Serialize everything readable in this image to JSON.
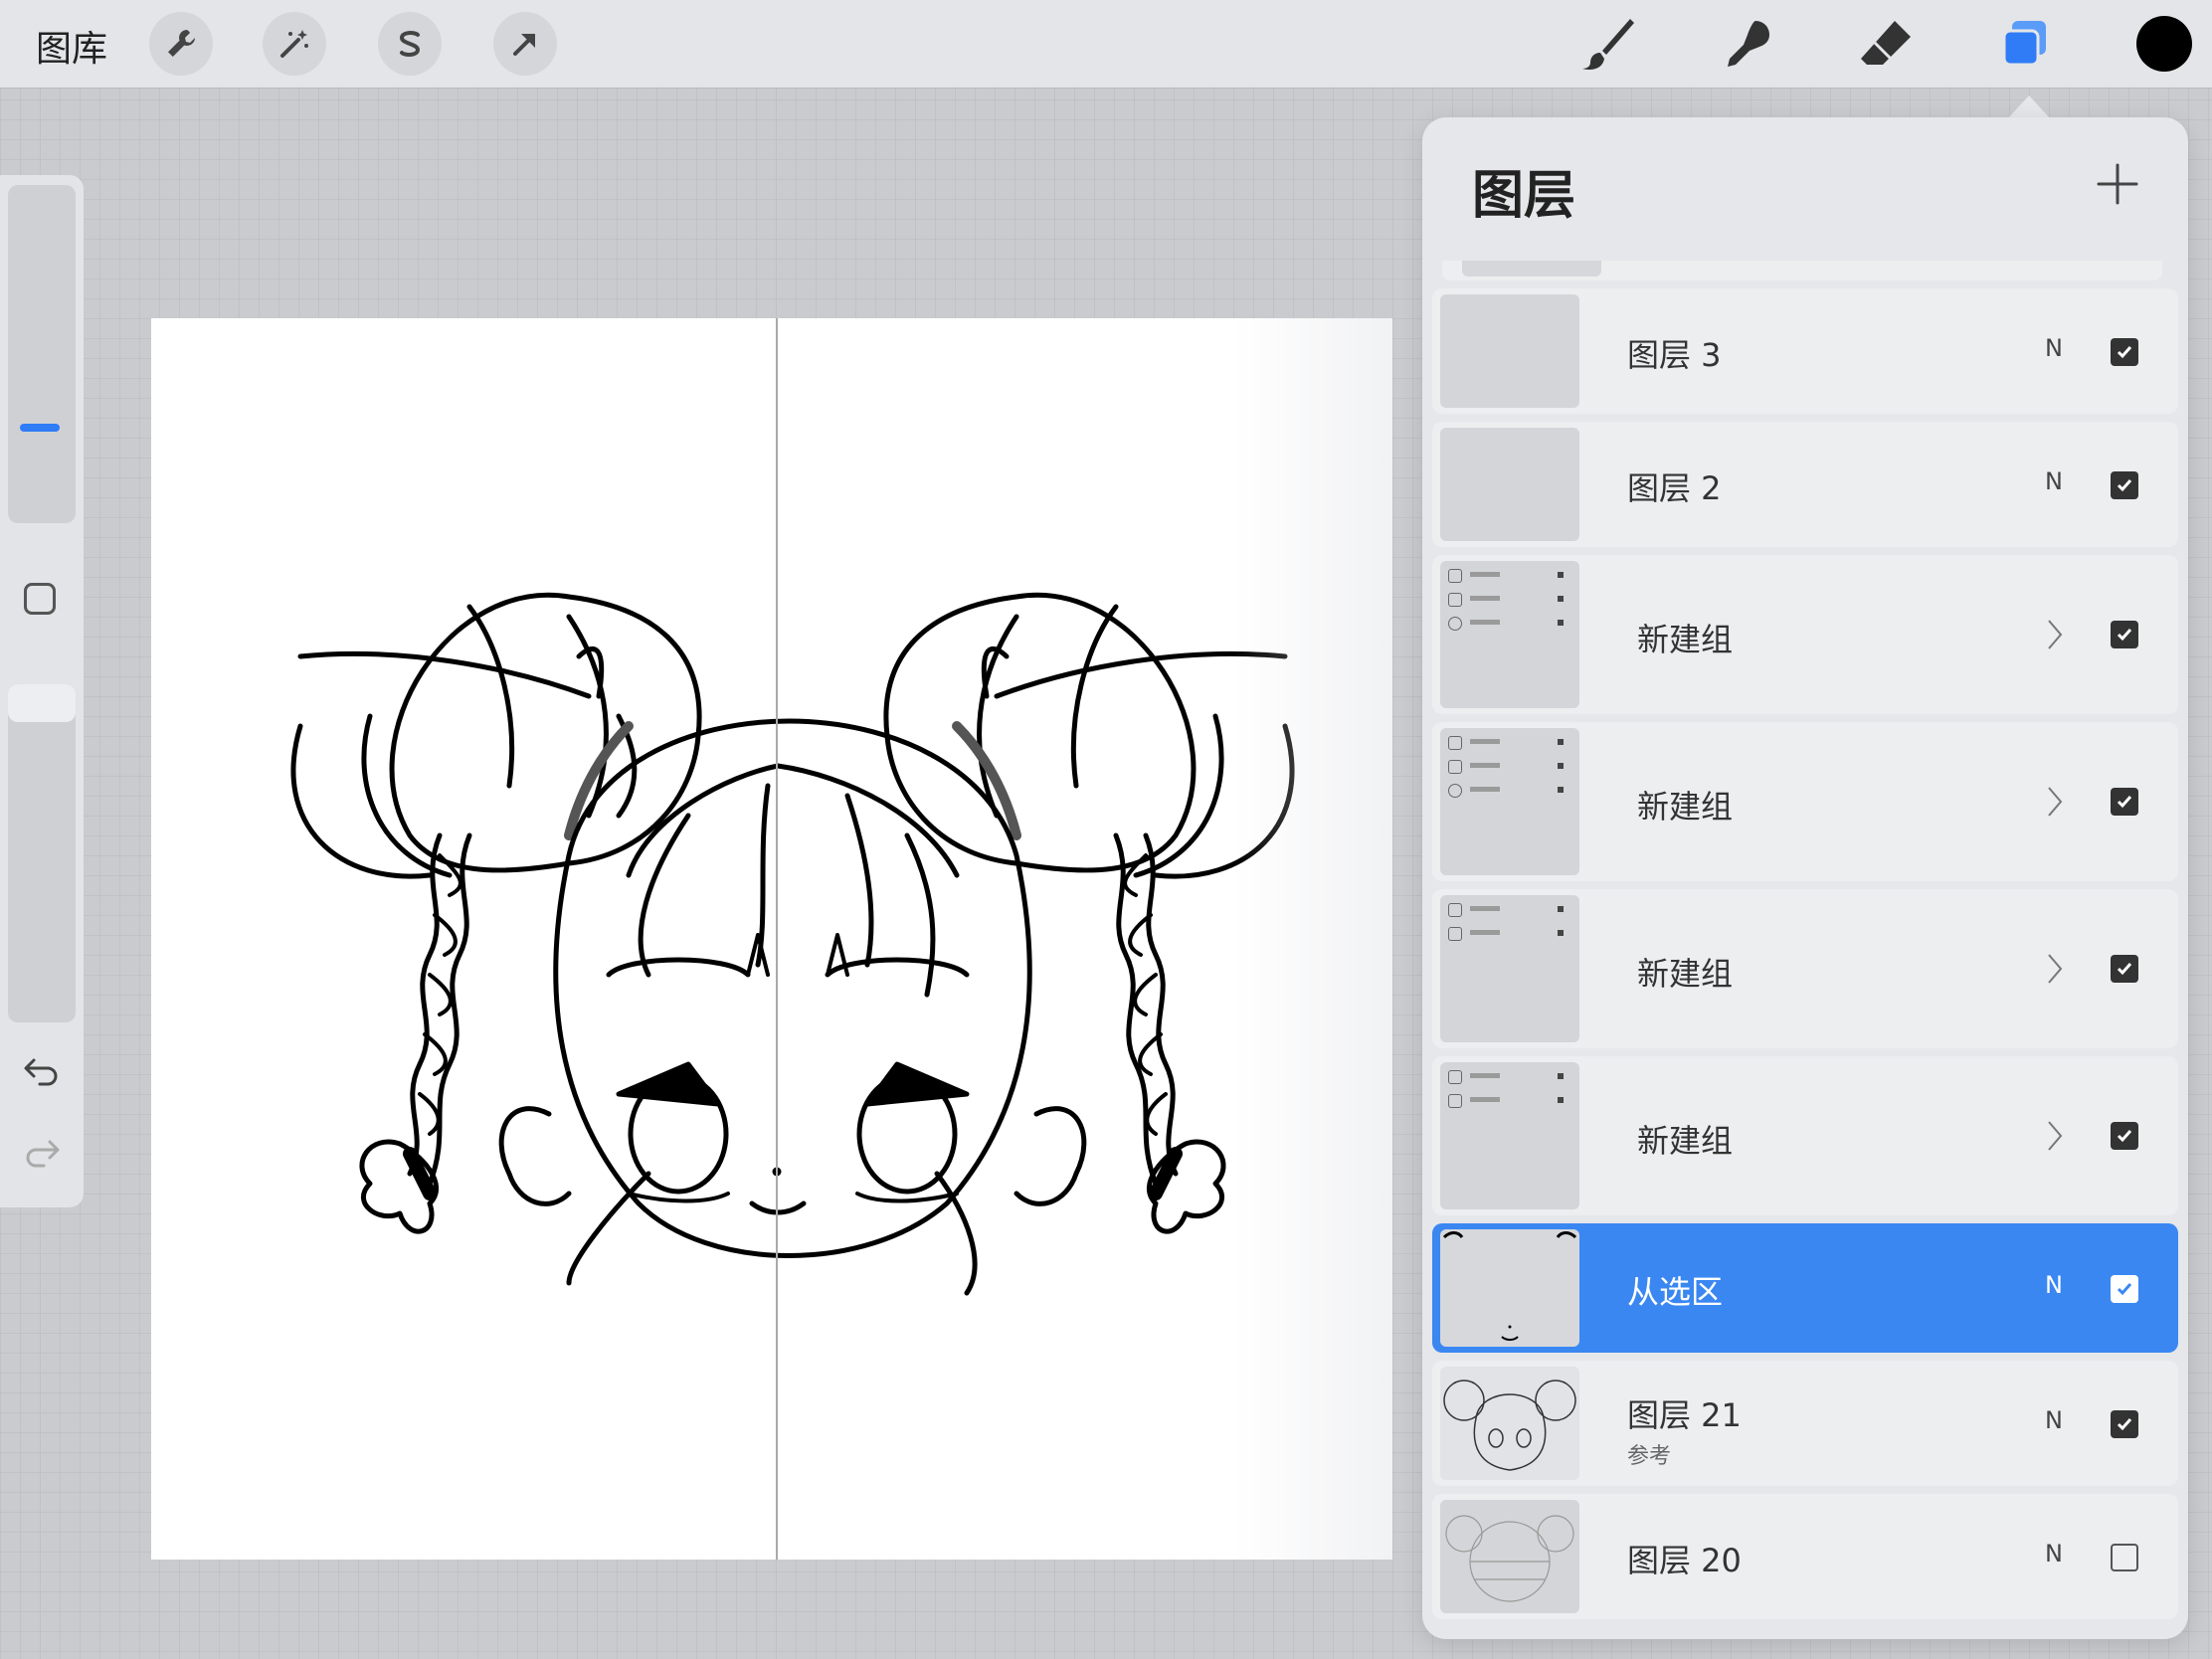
{
  "toolbar": {
    "gallery_label": "图库",
    "left_tools": [
      "wrench-icon",
      "magic-wand-icon",
      "selection-s-icon",
      "transform-arrow-icon"
    ],
    "right_tools": [
      "brush-icon",
      "smudge-icon",
      "eraser-icon",
      "layers-icon"
    ],
    "active_tool": "layers-icon",
    "accent_color": "#2f7cf6",
    "current_color": "#000000"
  },
  "sidebar": {
    "controls": [
      "brush-size-slider",
      "modify-button",
      "opacity-slider",
      "undo-icon",
      "redo-icon"
    ]
  },
  "layers_panel": {
    "title": "图层",
    "layers": [
      {
        "name": "图层 3",
        "blend": "N",
        "visible": true
      },
      {
        "name": "图层 2",
        "blend": "N",
        "visible": true
      },
      {
        "name": "新建组",
        "group": true,
        "visible": true
      },
      {
        "name": "新建组",
        "group": true,
        "visible": true
      },
      {
        "name": "新建组",
        "group": true,
        "visible": true
      },
      {
        "name": "新建组",
        "group": true,
        "visible": true
      },
      {
        "name": "从选区",
        "blend": "N",
        "visible": true,
        "selected": true
      },
      {
        "name": "图层 21",
        "sub": "参考",
        "blend": "N",
        "visible": true
      },
      {
        "name": "图层 20",
        "blend": "N",
        "visible": false
      }
    ],
    "selected_color": "#3a87f2"
  }
}
